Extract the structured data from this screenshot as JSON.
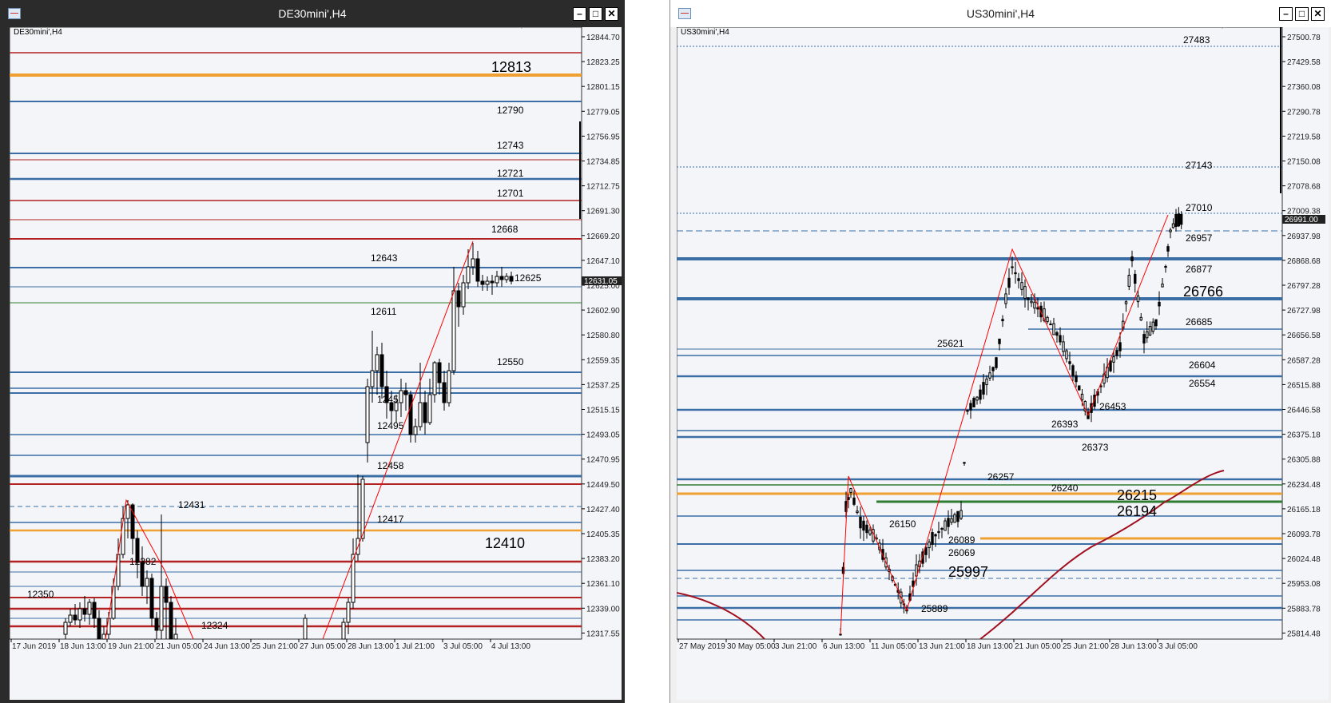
{
  "windows": [
    {
      "title": "DE30mini',H4",
      "symbol_label": "DE30mini',H4",
      "buttons": {
        "minimize": "–",
        "maximize": "□",
        "close": "✕"
      },
      "price_scale": [
        "12844.70",
        "12823.25",
        "12801.15",
        "12779.05",
        "12756.95",
        "12734.85",
        "12712.75",
        "12691.30",
        "12669.20",
        "12647.10",
        "12625.00",
        "12602.90",
        "12580.80",
        "12559.35",
        "12537.25",
        "12515.15",
        "12493.05",
        "12470.95",
        "12449.50",
        "12427.40",
        "12405.35",
        "12383.20",
        "12361.10",
        "12339.00",
        "12317.55"
      ],
      "current_price": "12631.05",
      "time_scale": [
        "17 Jun 2019",
        "18 Jun 13:00",
        "19 Jun 21:00",
        "21 Jun 05:00",
        "24 Jun 13:00",
        "25 Jun 21:00",
        "27 Jun 05:00",
        "28 Jun 13:00",
        "1 Jul 21:00",
        "3 Jul 05:00",
        "4 Jul 13:00"
      ],
      "levels": [
        {
          "label": "12813",
          "big": true
        },
        {
          "label": "12790"
        },
        {
          "label": "12743"
        },
        {
          "label": "12721"
        },
        {
          "label": "12701"
        },
        {
          "label": "12668"
        },
        {
          "label": "12643"
        },
        {
          "label": "12625"
        },
        {
          "label": "12611"
        },
        {
          "label": "12550"
        },
        {
          "label": "12495"
        },
        {
          "label": "12458"
        },
        {
          "label": "12431"
        },
        {
          "label": "12417"
        },
        {
          "label": "12410",
          "big": true
        },
        {
          "label": "12382"
        },
        {
          "label": "12350"
        },
        {
          "label": "12324"
        },
        {
          "label": "1245"
        }
      ]
    },
    {
      "title": "US30mini',H4",
      "symbol_label": "US30mini',H4",
      "buttons": {
        "minimize": "–",
        "maximize": "□",
        "close": "✕"
      },
      "price_scale": [
        "27500.78",
        "27429.58",
        "27360.08",
        "27290.78",
        "27219.58",
        "27150.08",
        "27078.68",
        "27009.38",
        "26937.98",
        "26868.68",
        "26797.28",
        "26727.98",
        "26656.58",
        "26587.28",
        "26515.88",
        "26446.58",
        "26375.18",
        "26305.88",
        "26234.48",
        "26165.18",
        "26093.78",
        "26024.48",
        "25953.08",
        "25883.78",
        "25814.48"
      ],
      "current_price": "26991.00",
      "time_scale": [
        "27 May 2019",
        "30 May 05:00",
        "3 Jun 21:00",
        "6 Jun 13:00",
        "11 Jun 05:00",
        "13 Jun 21:00",
        "18 Jun 13:00",
        "21 Jun 05:00",
        "25 Jun 21:00",
        "28 Jun 13:00",
        "3 Jul 05:00"
      ],
      "levels": [
        {
          "label": "27483"
        },
        {
          "label": "27143"
        },
        {
          "label": "27010"
        },
        {
          "label": "26957"
        },
        {
          "label": "26877"
        },
        {
          "label": "26766",
          "big": true
        },
        {
          "label": "26685"
        },
        {
          "label": "25621"
        },
        {
          "label": "26604"
        },
        {
          "label": "26554"
        },
        {
          "label": "26453"
        },
        {
          "label": "26393"
        },
        {
          "label": "26373"
        },
        {
          "label": "26257"
        },
        {
          "label": "26240"
        },
        {
          "label": "26215",
          "big": true
        },
        {
          "label": "26194",
          "big": true
        },
        {
          "label": "26150"
        },
        {
          "label": "26089"
        },
        {
          "label": "26069"
        },
        {
          "label": "25997",
          "big": true
        },
        {
          "label": "25889"
        }
      ]
    }
  ],
  "colors": {
    "red_line": "#b22222",
    "blue_line": "#3a6ea5",
    "orange_line": "#f0a030",
    "green_line": "#2e7d32",
    "zigzag": "#ff0000",
    "ma": "#a01020"
  }
}
